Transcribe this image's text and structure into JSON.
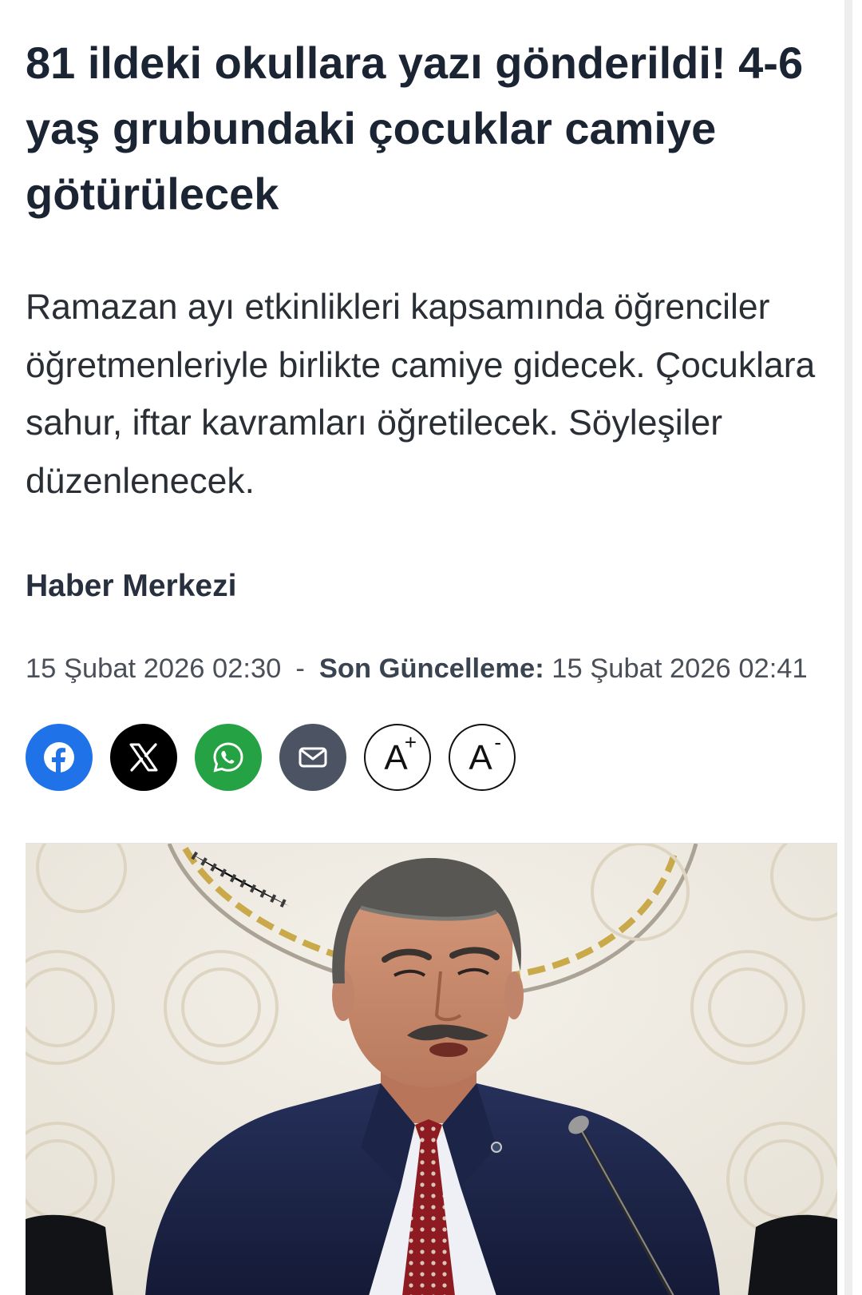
{
  "article": {
    "headline": "81 ildeki okullara yazı gönderildi! 4-6 yaş grubundaki çocuklar camiye götürülecek",
    "summary": "Ramazan ayı etkinlikleri kapsamında öğrenciler öğretmenleriyle birlikte camiye gidecek. Çocuklara sahur, iftar kavramları öğretilecek. Söyleşiler düzenlenecek.",
    "author": "Haber Merkezi",
    "published": "15 Şubat 2026 02:30",
    "separator": "-",
    "updated_label": "Son Güncelleme:",
    "updated": "15 Şubat 2026 02:41"
  },
  "share": {
    "facebook_icon": "facebook-icon",
    "x_icon": "x-icon",
    "whatsapp_icon": "whatsapp-icon",
    "mail_icon": "mail-icon",
    "font_increase_letter": "A",
    "font_increase_sign": "+",
    "font_decrease_letter": "A",
    "font_decrease_sign": "-"
  },
  "colors": {
    "facebook": "#1f72e8",
    "x": "#000000",
    "whatsapp": "#25a244",
    "mail": "#4c5464",
    "headline": "#1b2433"
  }
}
